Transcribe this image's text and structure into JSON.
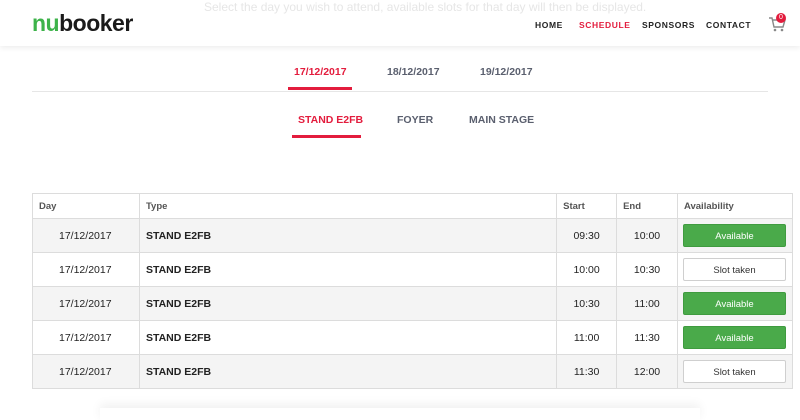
{
  "header": {
    "ghost_text": "Select the day you wish to attend, available slots for that day will then be displayed.",
    "logo_nu": "nu",
    "logo_booker": "booker",
    "nav": [
      {
        "label": "HOME",
        "active": false
      },
      {
        "label": "SCHEDULE",
        "active": true
      },
      {
        "label": "SPONSORS",
        "active": false
      },
      {
        "label": "CONTACT",
        "active": false
      }
    ],
    "cart_count": "0"
  },
  "date_tabs": [
    {
      "label": "17/12/2017",
      "active": true
    },
    {
      "label": "18/12/2017",
      "active": false
    },
    {
      "label": "19/12/2017",
      "active": false
    }
  ],
  "location_tabs": [
    {
      "label": "STAND E2FB",
      "active": true
    },
    {
      "label": "FOYER",
      "active": false
    },
    {
      "label": "MAIN STAGE",
      "active": false
    }
  ],
  "table": {
    "headers": [
      "Day",
      "Type",
      "Start",
      "End",
      "Availability"
    ],
    "rows": [
      {
        "day": "17/12/2017",
        "type": "STAND E2FB",
        "start": "09:30",
        "end": "10:00",
        "availability": "Available"
      },
      {
        "day": "17/12/2017",
        "type": "STAND E2FB",
        "start": "10:00",
        "end": "10:30",
        "availability": "Slot taken"
      },
      {
        "day": "17/12/2017",
        "type": "STAND E2FB",
        "start": "10:30",
        "end": "11:00",
        "availability": "Available"
      },
      {
        "day": "17/12/2017",
        "type": "STAND E2FB",
        "start": "11:00",
        "end": "11:30",
        "availability": "Available"
      },
      {
        "day": "17/12/2017",
        "type": "STAND E2FB",
        "start": "11:30",
        "end": "12:00",
        "availability": "Slot taken"
      }
    ]
  },
  "colors": {
    "accent": "#e31c3d",
    "brand_green": "#3db34a",
    "available": "#4aaa4a"
  }
}
